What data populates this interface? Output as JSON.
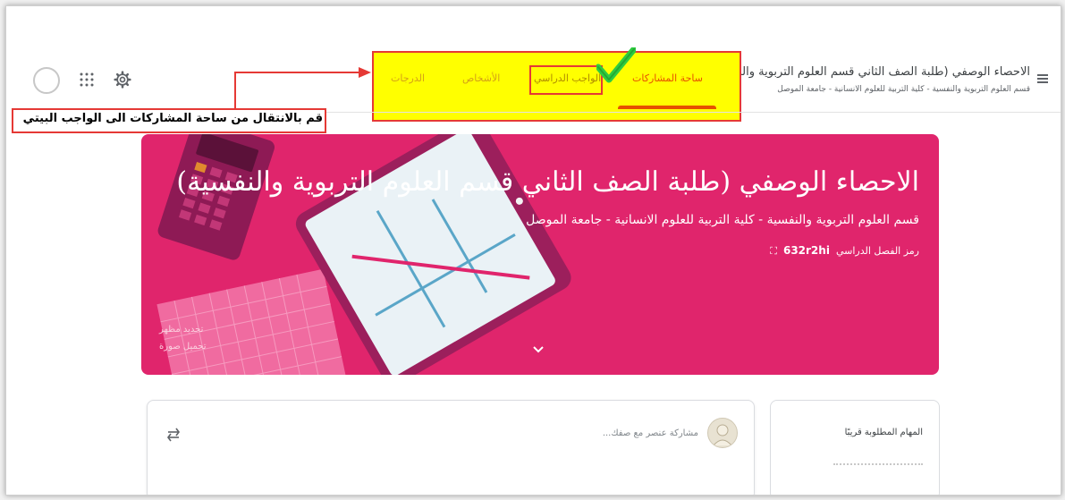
{
  "header": {
    "class_title": "الاحصاء الوصفي (طلبة الصف الثاني قسم العلوم التربوية والنفسية)",
    "class_subtitle": "قسم العلوم التربوية والنفسية - كلية التربية للعلوم الانسانية - جامعة الموصل",
    "tabs": [
      {
        "label": "ساحة المشاركات",
        "active": true
      },
      {
        "label": "الواجب الدراسي",
        "active": false
      },
      {
        "label": "الأشخاص",
        "active": false
      },
      {
        "label": "الدرجات",
        "active": false
      }
    ],
    "icons": [
      "menu-icon",
      "gear-icon",
      "apps-icon",
      "avatar"
    ]
  },
  "annotation": {
    "callout_text": "قم بالانتقال من ساحة المشاركات الى الواجب البيتي",
    "colors": {
      "highlight": "#ffff00",
      "border": "#e53935",
      "check": "#2ecc40"
    }
  },
  "banner": {
    "title": "الاحصاء الوصفي (طلبة الصف الثاني قسم العلوم التربوية والنفسية)",
    "subtitle": "قسم العلوم التربوية والنفسية - كلية التربية للعلوم الانسانية - جامعة الموصل",
    "class_code_label": "رمز الفصل الدراسي",
    "class_code": "632r2hi",
    "customize_label": "تحديد مظهر",
    "upload_label": "تحميل صورة",
    "color": "#e0256c"
  },
  "upcoming": {
    "title": "المهام المطلوبة قريبًا"
  },
  "stream": {
    "share_placeholder": "مشاركة عنصر مع صفك..."
  }
}
